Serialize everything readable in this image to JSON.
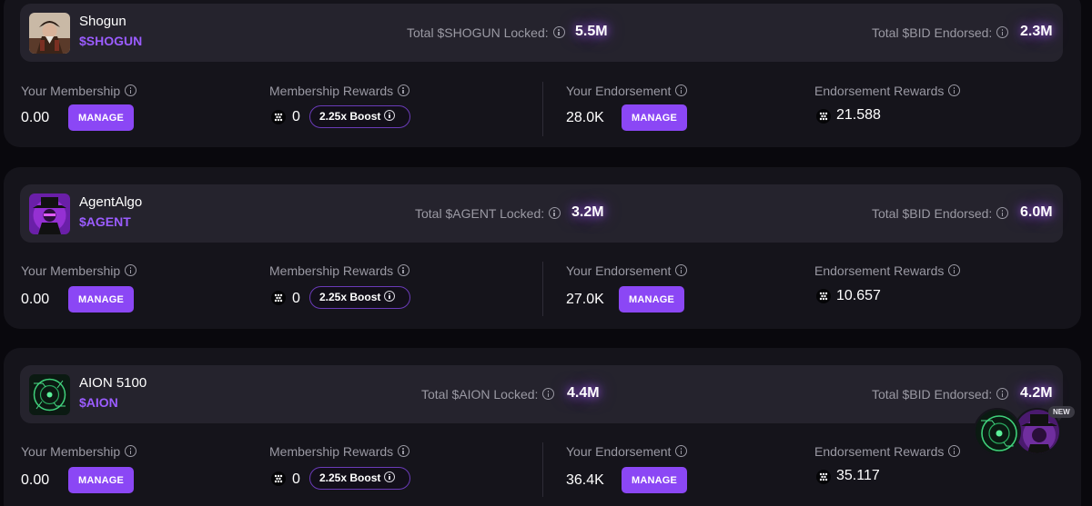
{
  "colors": {
    "accent": "#8b47f5",
    "ticker": "#9b5cff",
    "background": "#09080d",
    "card": "#15141b",
    "card_header": "#25232d",
    "muted_text": "#9a99a3"
  },
  "agents": [
    {
      "name": "Shogun",
      "ticker": "$SHOGUN",
      "avatar_icon": "samurai-avatar",
      "locked_label": "Total $SHOGUN Locked:",
      "locked_value": "5.5M",
      "endorsed_label": "Total $BID Endorsed:",
      "endorsed_value": "2.3M",
      "membership_label": "Your Membership",
      "membership_value": "0.00",
      "membership_button": "MANAGE",
      "membership_rewards_label": "Membership Rewards",
      "membership_rewards_value": "0",
      "boost_label": "2.25x Boost",
      "endorsement_label": "Your Endorsement",
      "endorsement_value": "28.0K",
      "endorsement_button": "MANAGE",
      "endorsement_rewards_label": "Endorsement Rewards",
      "endorsement_rewards_value": "21.588"
    },
    {
      "name": "AgentAlgo",
      "ticker": "$AGENT",
      "avatar_icon": "hat-agent-avatar",
      "locked_label": "Total $AGENT Locked:",
      "locked_value": "3.2M",
      "endorsed_label": "Total $BID Endorsed:",
      "endorsed_value": "6.0M",
      "membership_label": "Your Membership",
      "membership_value": "0.00",
      "membership_button": "MANAGE",
      "membership_rewards_label": "Membership Rewards",
      "membership_rewards_value": "0",
      "boost_label": "2.25x Boost",
      "endorsement_label": "Your Endorsement",
      "endorsement_value": "27.0K",
      "endorsement_button": "MANAGE",
      "endorsement_rewards_label": "Endorsement Rewards",
      "endorsement_rewards_value": "10.657"
    },
    {
      "name": "AION 5100",
      "ticker": "$AION",
      "avatar_icon": "green-circuit-avatar",
      "locked_label": "Total $AION Locked:",
      "locked_value": "4.4M",
      "endorsed_label": "Total $BID Endorsed:",
      "endorsed_value": "4.2M",
      "membership_label": "Your Membership",
      "membership_value": "0.00",
      "membership_button": "MANAGE",
      "membership_rewards_label": "Membership Rewards",
      "membership_rewards_value": "0",
      "boost_label": "2.25x Boost",
      "endorsement_label": "Your Endorsement",
      "endorsement_value": "36.4K",
      "endorsement_button": "MANAGE",
      "endorsement_rewards_label": "Endorsement Rewards",
      "endorsement_rewards_value": "35.117"
    }
  ],
  "floating_widget": {
    "badge": "NEW"
  }
}
